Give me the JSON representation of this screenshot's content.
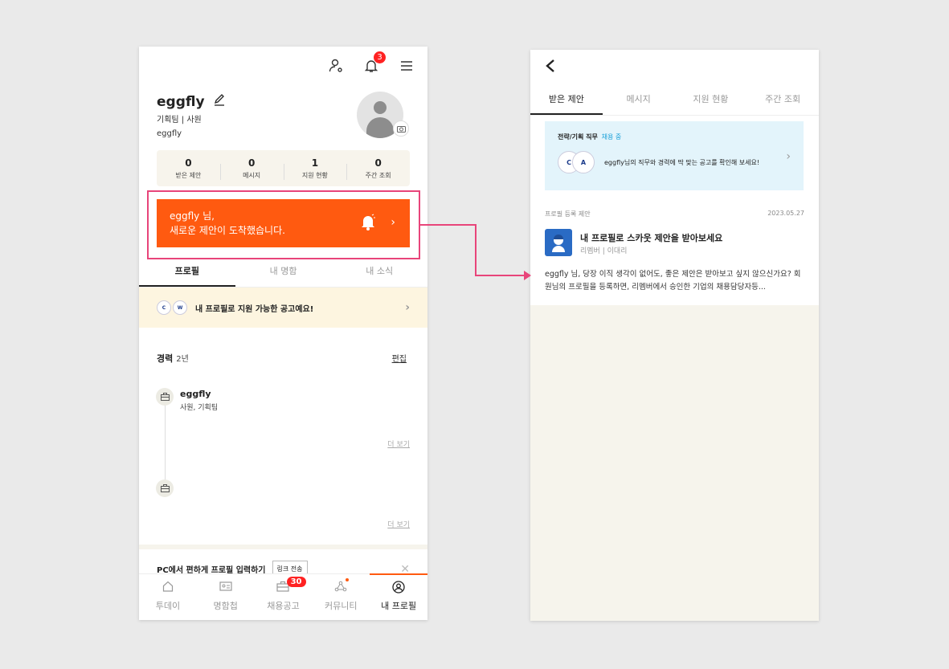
{
  "left": {
    "header": {
      "notif_count": "3"
    },
    "profile": {
      "name": "eggfly",
      "dept_role": "기획팀 | 사원",
      "company": "eggfly"
    },
    "stats": [
      {
        "value": "0",
        "label": "받은 제안"
      },
      {
        "value": "0",
        "label": "메시지"
      },
      {
        "value": "1",
        "label": "지원 현황"
      },
      {
        "value": "0",
        "label": "주간 조회"
      }
    ],
    "alert": {
      "line1": "eggfly 님,",
      "line2": "새로운 제안이 도착했습니다."
    },
    "tabs": [
      "프로필",
      "내 명함",
      "내 소식"
    ],
    "banner": {
      "text": "내 프로필로 지원 가능한 공고예요!"
    },
    "career": {
      "title": "경력",
      "years": "2년",
      "edit": "편집"
    },
    "job": {
      "name": "eggfly",
      "detail": "사원, 기획팀"
    },
    "more_label": "더 보기",
    "pc_bar": {
      "text": "PC에서 편하게 프로필 입력하기",
      "button": "링크 전송"
    },
    "nav": [
      {
        "label": "투데이"
      },
      {
        "label": "명함첩"
      },
      {
        "label": "채용공고",
        "badge": "30"
      },
      {
        "label": "커뮤니티"
      },
      {
        "label": "내 프로필"
      }
    ]
  },
  "right": {
    "tabs": [
      "받은 제안",
      "메시지",
      "지원 현황",
      "주간 조회"
    ],
    "reco": {
      "role": "전략/기획 직무",
      "status": "채용 중",
      "text": "eggfly님의 직무와 경력에 딱 맞는 공고를 확인해 보세요!"
    },
    "section": {
      "label": "프로필 등록 제안",
      "date": "2023.05.27"
    },
    "message": {
      "title": "내 프로필로 스카웃 제안을 받아보세요",
      "sender": "리멤버 | 이대리",
      "body": "eggfly 님, 당장 이직 생각이 없어도, 좋은 제안은 받아보고 싶지 않으신가요?  회원님의 프로필을 등록하면, 리멤버에서 승인한 기업의 채용담당자등..."
    }
  },
  "colors": {
    "accent": "#ff5a10",
    "highlight": "#e8457a",
    "badge": "#ff2222"
  }
}
